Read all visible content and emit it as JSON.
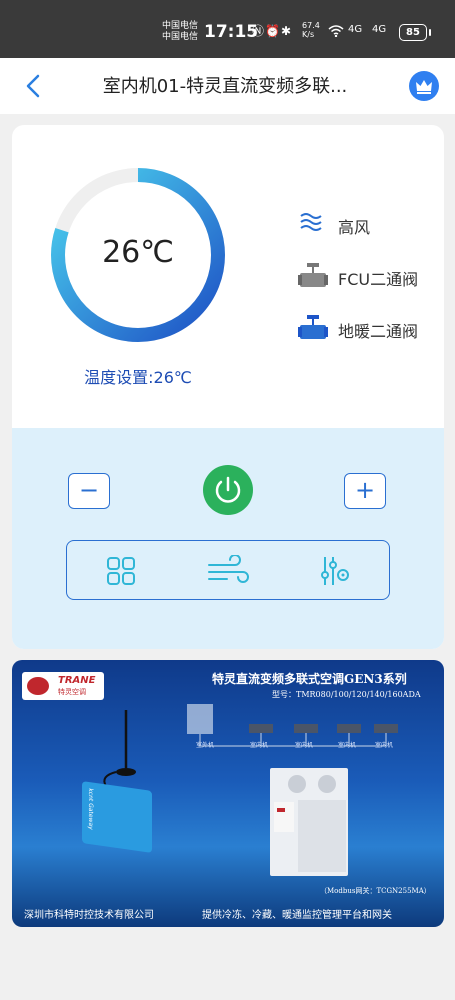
{
  "status_bar": {
    "carrier_1": "中国电信",
    "carrier_2": "中国电信",
    "time": "17:15",
    "speed_value": "67.4",
    "speed_unit": "K/s",
    "signal_1": "4G",
    "signal_2": "4G",
    "battery": "85"
  },
  "header": {
    "title": "室内机01-特灵直流变频多联...",
    "back_icon": "chevron-left-icon",
    "vip_icon": "crown-icon",
    "accent": "#2f7ff0"
  },
  "thermostat": {
    "current_temp": "26℃",
    "setpoint_text": "温度设置:26℃",
    "dial_fraction": 0.8,
    "gradient_start": "#1d4fc4",
    "gradient_end": "#4dd6f0"
  },
  "status_items": [
    {
      "icon": "wind-icon",
      "label": "高风"
    },
    {
      "icon": "valve-icon",
      "label": "FCU二通阀"
    },
    {
      "icon": "valve-icon",
      "label": "地暖二通阀"
    }
  ],
  "controls": {
    "minus_label": "−",
    "plus_label": "+",
    "power_icon": "power-icon",
    "power_color": "#2bb15c",
    "mode_icons": [
      "grid-icon",
      "wind-icon",
      "sliders-icon"
    ]
  },
  "banner": {
    "brand": "TRANE",
    "brand_sub": "特灵空调",
    "title": "特灵直流变频多联式空调GEN3系列",
    "model": "型号：TMR080/100/120/140/160ADA",
    "unit_labels": [
      "室外机",
      "室内机",
      "室内机",
      "室内机",
      "室内机"
    ],
    "device_brand": "kcnt",
    "device_name": "Gateway",
    "modbus": "（Modbus网关：TCGN255MA）",
    "footer_left": "深圳市科特时控技术有限公司",
    "footer_right": "提供冷冻、冷藏、暖通监控管理平台和网关"
  }
}
